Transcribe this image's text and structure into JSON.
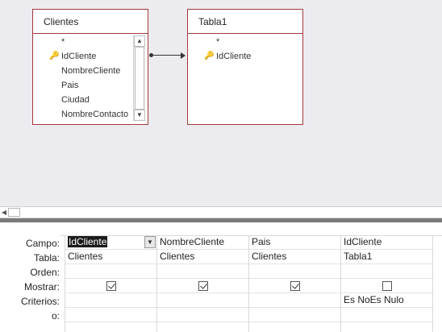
{
  "tables": [
    {
      "title": "Clientes",
      "fields": [
        {
          "name": "*",
          "key": false
        },
        {
          "name": "IdCliente",
          "key": true
        },
        {
          "name": "NombreCliente",
          "key": false
        },
        {
          "name": "Pais",
          "key": false
        },
        {
          "name": "Ciudad",
          "key": false
        },
        {
          "name": "NombreContacto",
          "key": false
        }
      ]
    },
    {
      "title": "Tabla1",
      "fields": [
        {
          "name": "*",
          "key": false
        },
        {
          "name": "IdCliente",
          "key": true
        }
      ]
    }
  ],
  "grid": {
    "row_labels": {
      "campo": "Campo:",
      "tabla": "Tabla:",
      "orden": "Orden:",
      "mostrar": "Mostrar:",
      "criterios": "Criterios:",
      "o": "o:"
    },
    "columns": [
      {
        "campo": "IdCliente",
        "tabla": "Clientes",
        "orden": "",
        "mostrar": true,
        "criterios": "",
        "o": ""
      },
      {
        "campo": "NombreCliente",
        "tabla": "Clientes",
        "orden": "",
        "mostrar": true,
        "criterios": "",
        "o": ""
      },
      {
        "campo": "Pais",
        "tabla": "Clientes",
        "orden": "",
        "mostrar": true,
        "criterios": "",
        "o": ""
      },
      {
        "campo": "IdCliente",
        "tabla": "Tabla1",
        "orden": "",
        "mostrar": false,
        "criterios": "Es NoEs Nulo",
        "o": ""
      }
    ]
  },
  "icons": {
    "key": "key-icon",
    "scroll_up": "scroll-up-arrow-icon",
    "scroll_down": "scroll-down-arrow-icon",
    "scroll_left": "scroll-left-arrow-icon",
    "dropdown": "chevron-down-icon"
  },
  "colors": {
    "table_border": "#a4373a",
    "design_bg": "#ececf0",
    "splitter": "#7a7a7a"
  }
}
